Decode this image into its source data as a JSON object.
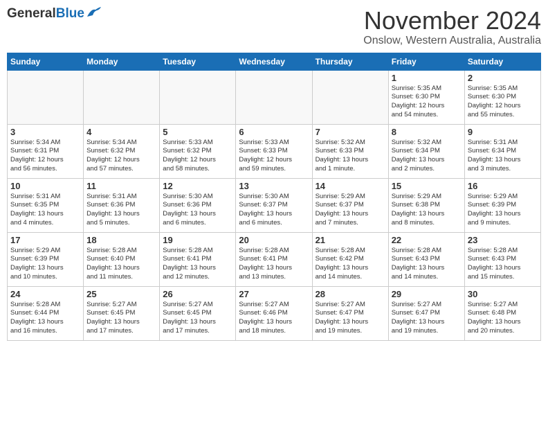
{
  "header": {
    "logo_general": "General",
    "logo_blue": "Blue",
    "month": "November 2024",
    "location": "Onslow, Western Australia, Australia"
  },
  "weekdays": [
    "Sunday",
    "Monday",
    "Tuesday",
    "Wednesday",
    "Thursday",
    "Friday",
    "Saturday"
  ],
  "weeks": [
    [
      {
        "day": "",
        "info": ""
      },
      {
        "day": "",
        "info": ""
      },
      {
        "day": "",
        "info": ""
      },
      {
        "day": "",
        "info": ""
      },
      {
        "day": "",
        "info": ""
      },
      {
        "day": "1",
        "info": "Sunrise: 5:35 AM\nSunset: 6:30 PM\nDaylight: 12 hours and 54 minutes."
      },
      {
        "day": "2",
        "info": "Sunrise: 5:35 AM\nSunset: 6:30 PM\nDaylight: 12 hours and 55 minutes."
      }
    ],
    [
      {
        "day": "3",
        "info": "Sunrise: 5:34 AM\nSunset: 6:31 PM\nDaylight: 12 hours and 56 minutes."
      },
      {
        "day": "4",
        "info": "Sunrise: 5:34 AM\nSunset: 6:32 PM\nDaylight: 12 hours and 57 minutes."
      },
      {
        "day": "5",
        "info": "Sunrise: 5:33 AM\nSunset: 6:32 PM\nDaylight: 12 hours and 58 minutes."
      },
      {
        "day": "6",
        "info": "Sunrise: 5:33 AM\nSunset: 6:33 PM\nDaylight: 12 hours and 59 minutes."
      },
      {
        "day": "7",
        "info": "Sunrise: 5:32 AM\nSunset: 6:33 PM\nDaylight: 13 hours and 1 minute."
      },
      {
        "day": "8",
        "info": "Sunrise: 5:32 AM\nSunset: 6:34 PM\nDaylight: 13 hours and 2 minutes."
      },
      {
        "day": "9",
        "info": "Sunrise: 5:31 AM\nSunset: 6:34 PM\nDaylight: 13 hours and 3 minutes."
      }
    ],
    [
      {
        "day": "10",
        "info": "Sunrise: 5:31 AM\nSunset: 6:35 PM\nDaylight: 13 hours and 4 minutes."
      },
      {
        "day": "11",
        "info": "Sunrise: 5:31 AM\nSunset: 6:36 PM\nDaylight: 13 hours and 5 minutes."
      },
      {
        "day": "12",
        "info": "Sunrise: 5:30 AM\nSunset: 6:36 PM\nDaylight: 13 hours and 6 minutes."
      },
      {
        "day": "13",
        "info": "Sunrise: 5:30 AM\nSunset: 6:37 PM\nDaylight: 13 hours and 6 minutes."
      },
      {
        "day": "14",
        "info": "Sunrise: 5:29 AM\nSunset: 6:37 PM\nDaylight: 13 hours and 7 minutes."
      },
      {
        "day": "15",
        "info": "Sunrise: 5:29 AM\nSunset: 6:38 PM\nDaylight: 13 hours and 8 minutes."
      },
      {
        "day": "16",
        "info": "Sunrise: 5:29 AM\nSunset: 6:39 PM\nDaylight: 13 hours and 9 minutes."
      }
    ],
    [
      {
        "day": "17",
        "info": "Sunrise: 5:29 AM\nSunset: 6:39 PM\nDaylight: 13 hours and 10 minutes."
      },
      {
        "day": "18",
        "info": "Sunrise: 5:28 AM\nSunset: 6:40 PM\nDaylight: 13 hours and 11 minutes."
      },
      {
        "day": "19",
        "info": "Sunrise: 5:28 AM\nSunset: 6:41 PM\nDaylight: 13 hours and 12 minutes."
      },
      {
        "day": "20",
        "info": "Sunrise: 5:28 AM\nSunset: 6:41 PM\nDaylight: 13 hours and 13 minutes."
      },
      {
        "day": "21",
        "info": "Sunrise: 5:28 AM\nSunset: 6:42 PM\nDaylight: 13 hours and 14 minutes."
      },
      {
        "day": "22",
        "info": "Sunrise: 5:28 AM\nSunset: 6:43 PM\nDaylight: 13 hours and 14 minutes."
      },
      {
        "day": "23",
        "info": "Sunrise: 5:28 AM\nSunset: 6:43 PM\nDaylight: 13 hours and 15 minutes."
      }
    ],
    [
      {
        "day": "24",
        "info": "Sunrise: 5:28 AM\nSunset: 6:44 PM\nDaylight: 13 hours and 16 minutes."
      },
      {
        "day": "25",
        "info": "Sunrise: 5:27 AM\nSunset: 6:45 PM\nDaylight: 13 hours and 17 minutes."
      },
      {
        "day": "26",
        "info": "Sunrise: 5:27 AM\nSunset: 6:45 PM\nDaylight: 13 hours and 17 minutes."
      },
      {
        "day": "27",
        "info": "Sunrise: 5:27 AM\nSunset: 6:46 PM\nDaylight: 13 hours and 18 minutes."
      },
      {
        "day": "28",
        "info": "Sunrise: 5:27 AM\nSunset: 6:47 PM\nDaylight: 13 hours and 19 minutes."
      },
      {
        "day": "29",
        "info": "Sunrise: 5:27 AM\nSunset: 6:47 PM\nDaylight: 13 hours and 19 minutes."
      },
      {
        "day": "30",
        "info": "Sunrise: 5:27 AM\nSunset: 6:48 PM\nDaylight: 13 hours and 20 minutes."
      }
    ]
  ]
}
